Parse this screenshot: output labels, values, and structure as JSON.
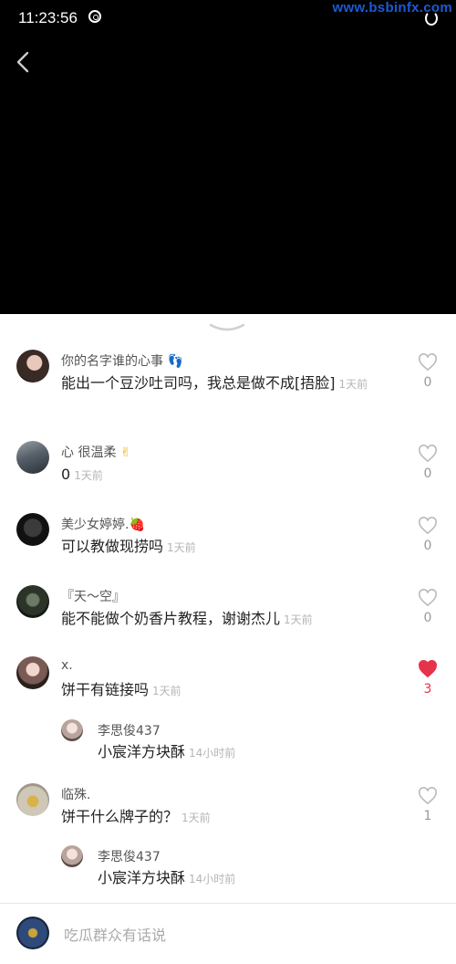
{
  "status": {
    "time": "11:23:56"
  },
  "watermark": "www.bsbinfx.com",
  "comments": [
    {
      "user": "你的名字谁的心事",
      "text": "能出一个豆沙吐司吗，我总是做不成[捂脸]",
      "time": "1天前",
      "likes": "0",
      "liked": false
    },
    {
      "user": "心  很温柔",
      "text": "0",
      "time": "1天前",
      "likes": "0",
      "liked": false
    },
    {
      "user": "美少女婷婷.",
      "text": "可以教做现捞吗",
      "time": "1天前",
      "likes": "0",
      "liked": false
    },
    {
      "user": "『天～空』",
      "text": "能不能做个奶香片教程，谢谢杰儿",
      "time": "1天前",
      "likes": "0",
      "liked": false
    },
    {
      "user": "x.",
      "text": "饼干有链接吗",
      "time": "1天前",
      "likes": "3",
      "liked": true
    },
    {
      "user": "临殊.",
      "text": "饼干什么牌子的？",
      "time": "1天前",
      "likes": "1",
      "liked": false
    }
  ],
  "replies": [
    {
      "user": "李思俊437",
      "text": "小宸洋方块酥",
      "time": "14小时前"
    },
    {
      "user": "李思俊437",
      "text": "小宸洋方块酥",
      "time": "14小时前"
    }
  ],
  "input": {
    "placeholder": "吃瓜群众有话说"
  },
  "colors": {
    "like_active": "#e5334b",
    "watermark": "#1a5bd6"
  }
}
